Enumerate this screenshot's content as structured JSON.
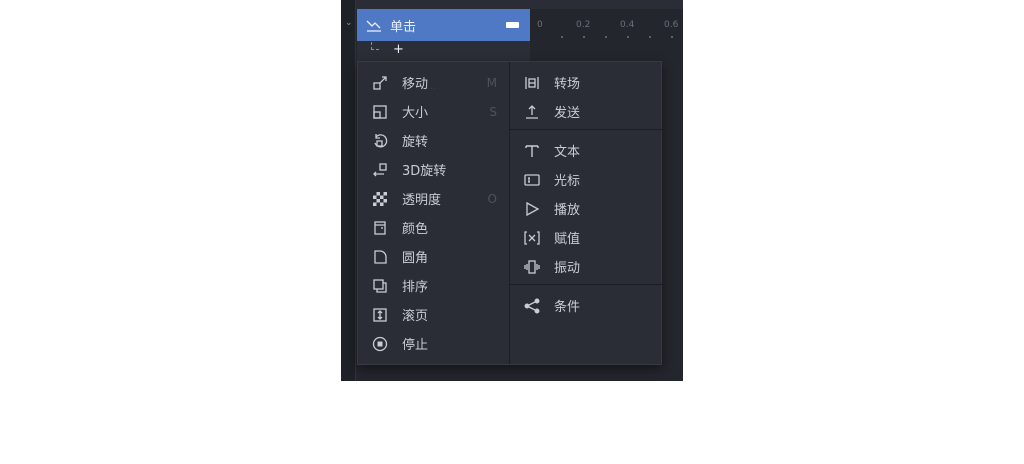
{
  "trigger": {
    "label": "单击",
    "icon": "swipe-icon"
  },
  "ruler": {
    "ticks": [
      "0",
      "0.2",
      "0.4",
      "0.6"
    ]
  },
  "subrow": {
    "add_label": "+"
  },
  "menu": {
    "left_items": [
      {
        "label": "移动",
        "shortcut": "M",
        "icon": "move-icon"
      },
      {
        "label": "大小",
        "shortcut": "S",
        "icon": "resize-icon"
      },
      {
        "label": "旋转",
        "shortcut": "",
        "icon": "rotate-icon"
      },
      {
        "label": "3D旋转",
        "shortcut": "",
        "icon": "rotate-3d-icon"
      },
      {
        "label": "透明度",
        "shortcut": "O",
        "icon": "opacity-icon"
      },
      {
        "label": "颜色",
        "shortcut": "",
        "icon": "color-icon"
      },
      {
        "label": "圆角",
        "shortcut": "",
        "icon": "corner-radius-icon"
      },
      {
        "label": "排序",
        "shortcut": "",
        "icon": "order-icon"
      },
      {
        "label": "滚页",
        "shortcut": "",
        "icon": "scroll-icon"
      },
      {
        "label": "停止",
        "shortcut": "",
        "icon": "stop-icon"
      }
    ],
    "right_items": [
      {
        "label": "转场",
        "icon": "transition-icon"
      },
      {
        "label": "发送",
        "icon": "send-icon"
      },
      {
        "label": "文本",
        "icon": "text-icon"
      },
      {
        "label": "光标",
        "icon": "cursor-icon"
      },
      {
        "label": "播放",
        "icon": "play-icon"
      },
      {
        "label": "赋值",
        "icon": "variable-icon"
      },
      {
        "label": "振动",
        "icon": "vibrate-icon"
      },
      {
        "label": "条件",
        "icon": "condition-icon"
      }
    ]
  },
  "colors": {
    "accent": "#4f79c4",
    "menu_bg": "#2a2d35",
    "text": "#c9ccd2"
  }
}
